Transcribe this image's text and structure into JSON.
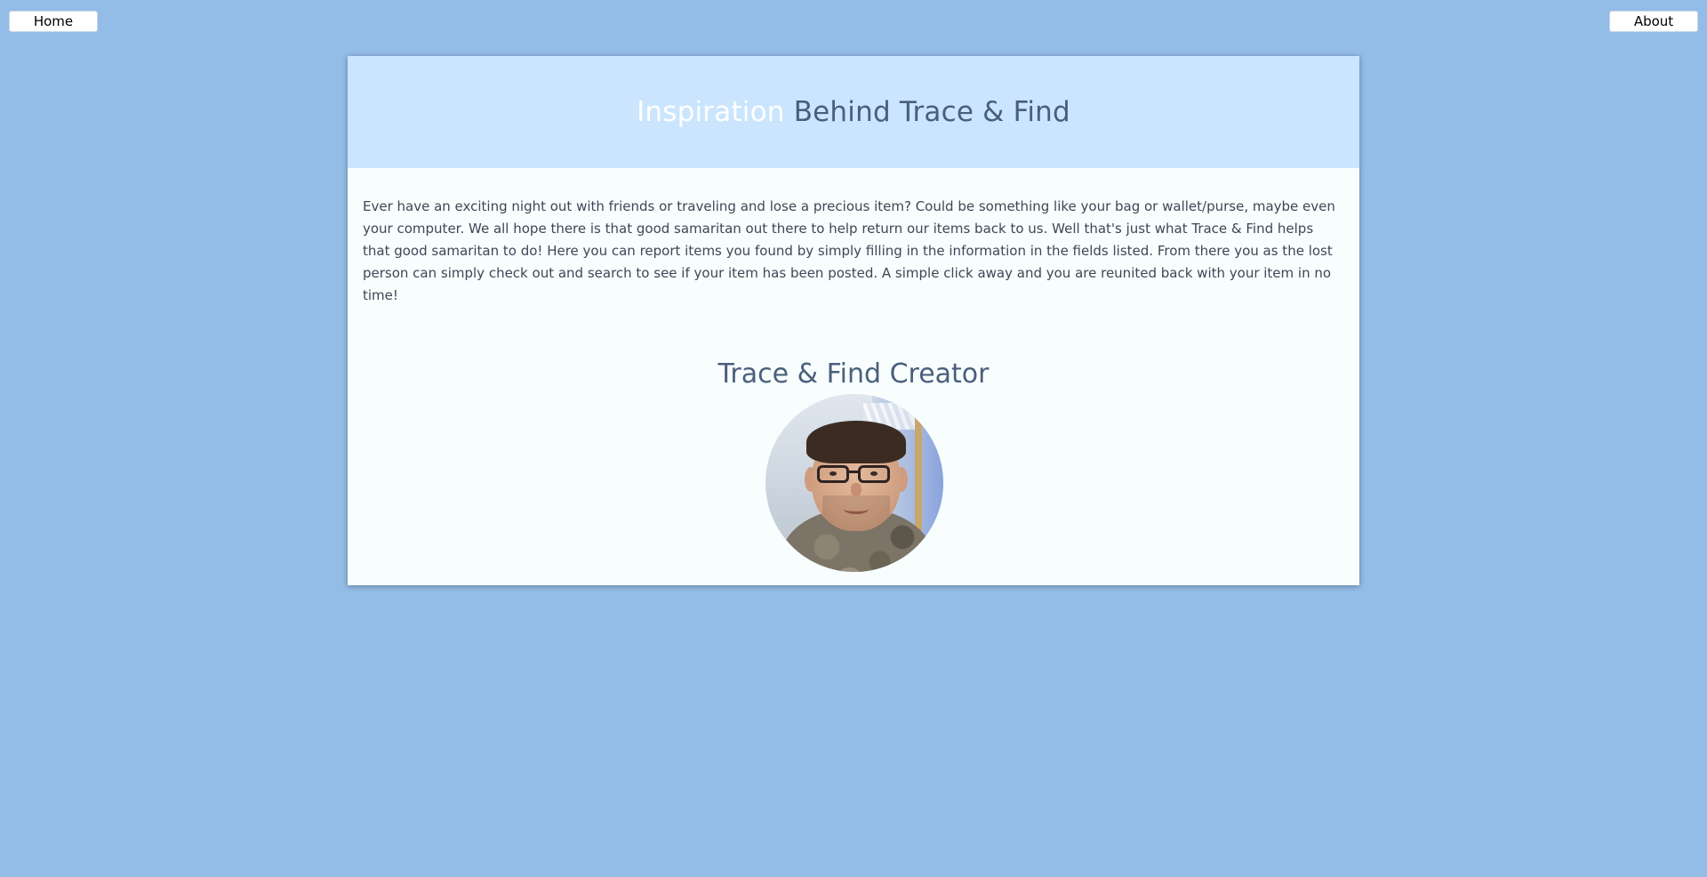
{
  "nav": {
    "home_label": "Home",
    "about_label": "About"
  },
  "header": {
    "title_highlight": "Inspiration",
    "title_rest": " Behind Trace & Find"
  },
  "content": {
    "intro_text": "Ever have an exciting night out with friends or traveling and lose a precious item? Could be something like your bag or wallet/purse, maybe even your computer. We all hope there is that good samaritan out there to help return our items back to us. Well that's just what Trace & Find helps that good samaritan to do! Here you can report items you found by simply filling in the information in the fields listed. From there you as the lost person can simply check out and search to see if your item has been posted. A simple click away and you are reunited back with your item in no time!",
    "creator_title": "Trace & Find Creator"
  },
  "colors": {
    "page_background": "#93bce6",
    "header_background": "#cae5fd",
    "card_background": "#f8fefe",
    "title_text": "#485f7a",
    "highlight_text": "#ffffff"
  }
}
